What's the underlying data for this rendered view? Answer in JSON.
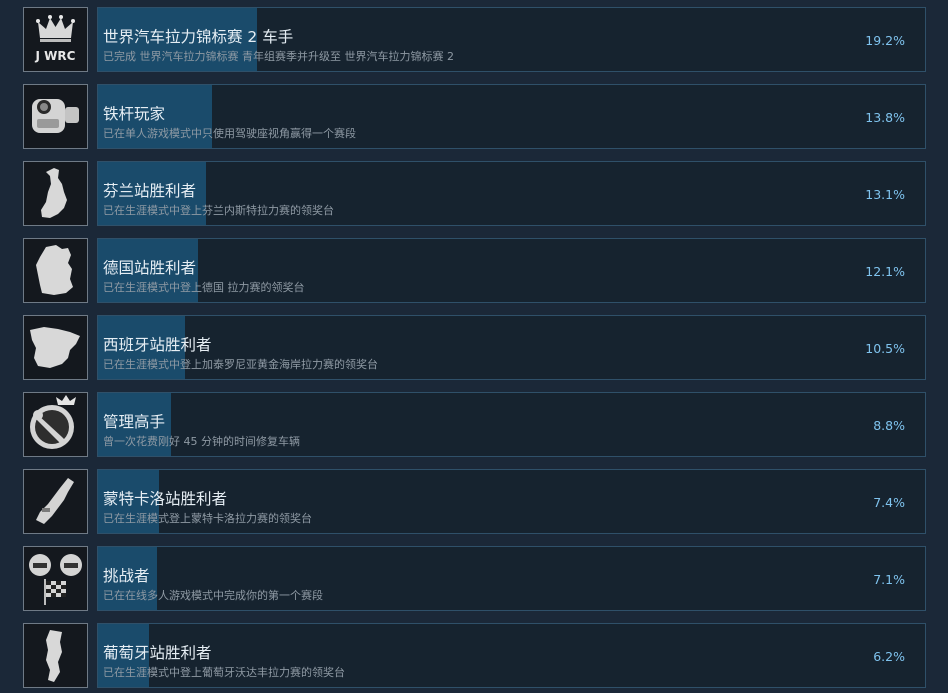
{
  "colors": {
    "background": "#1b2838",
    "bar_fill": "#1a4b6b",
    "percent_text": "#7fc3ee",
    "icon_silver": "#d8d8d8"
  },
  "achievements": [
    {
      "icon": "jwrc-crown-icon",
      "title": "世界汽车拉力锦标赛 2 车手",
      "desc": "已完成 世界汽车拉力锦标赛 青年组赛季并升级至 世界汽车拉力锦标赛 2",
      "percent": "19.2%",
      "percent_value": 19.2,
      "icon_text": "J WRC"
    },
    {
      "icon": "camera-icon",
      "title": "铁杆玩家",
      "desc": "已在单人游戏模式中只使用驾驶座视角赢得一个赛段",
      "percent": "13.8%",
      "percent_value": 13.8
    },
    {
      "icon": "finland-map-icon",
      "title": "芬兰站胜利者",
      "desc": "已在生涯模式中登上芬兰内斯特拉力赛的领奖台",
      "percent": "13.1%",
      "percent_value": 13.1
    },
    {
      "icon": "germany-map-icon",
      "title": "德国站胜利者",
      "desc": "已在生涯模式中登上德国 拉力赛的领奖台",
      "percent": "12.1%",
      "percent_value": 12.1
    },
    {
      "icon": "spain-map-icon",
      "title": "西班牙站胜利者",
      "desc": "已在生涯模式中登上加泰罗尼亚黄金海岸拉力赛的领奖台",
      "percent": "10.5%",
      "percent_value": 10.5
    },
    {
      "icon": "wrench-crown-icon",
      "title": "管理高手",
      "desc": "曾一次花费刚好 45 分钟的时间修复车辆",
      "percent": "8.8%",
      "percent_value": 8.8
    },
    {
      "icon": "monaco-map-icon",
      "title": "蒙特卡洛站胜利者",
      "desc": "已在生涯模式登上蒙特卡洛拉力赛的领奖台",
      "percent": "7.4%",
      "percent_value": 7.4
    },
    {
      "icon": "helmets-flag-icon",
      "title": "挑战者",
      "desc": "已在在线多人游戏模式中完成你的第一个赛段",
      "percent": "7.1%",
      "percent_value": 7.1
    },
    {
      "icon": "portugal-map-icon",
      "title": "葡萄牙站胜利者",
      "desc": "已在生涯模式中登上葡萄牙沃达丰拉力赛的领奖台",
      "percent": "6.2%",
      "percent_value": 6.2
    }
  ]
}
